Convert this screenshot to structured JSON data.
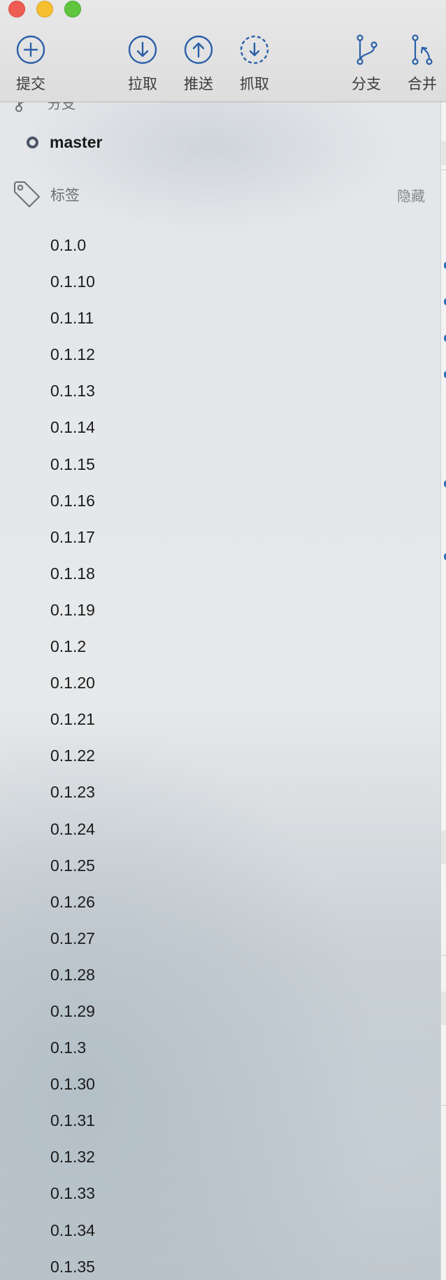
{
  "toolbar": {
    "commit_label": "提交",
    "pull_label": "拉取",
    "push_label": "推送",
    "fetch_label": "抓取",
    "branch_label": "分支",
    "merge_label": "合并"
  },
  "sidebar": {
    "branches_header": "分支",
    "current_branch": "master",
    "tags_header": "标签",
    "tags_hide": "隐藏",
    "tags": [
      "0.1.0",
      "0.1.10",
      "0.1.11",
      "0.1.12",
      "0.1.13",
      "0.1.14",
      "0.1.15",
      "0.1.16",
      "0.1.17",
      "0.1.18",
      "0.1.19",
      "0.1.2",
      "0.1.20",
      "0.1.21",
      "0.1.22",
      "0.1.23",
      "0.1.24",
      "0.1.25",
      "0.1.26",
      "0.1.27",
      "0.1.28",
      "0.1.29",
      "0.1.3",
      "0.1.30",
      "0.1.31",
      "0.1.32",
      "0.1.33",
      "0.1.34",
      "0.1.35"
    ]
  },
  "colors": {
    "accent": "#2f6fb5",
    "close": "#ee5c54",
    "minimize": "#f5bf2f",
    "zoom": "#5fc53f"
  }
}
